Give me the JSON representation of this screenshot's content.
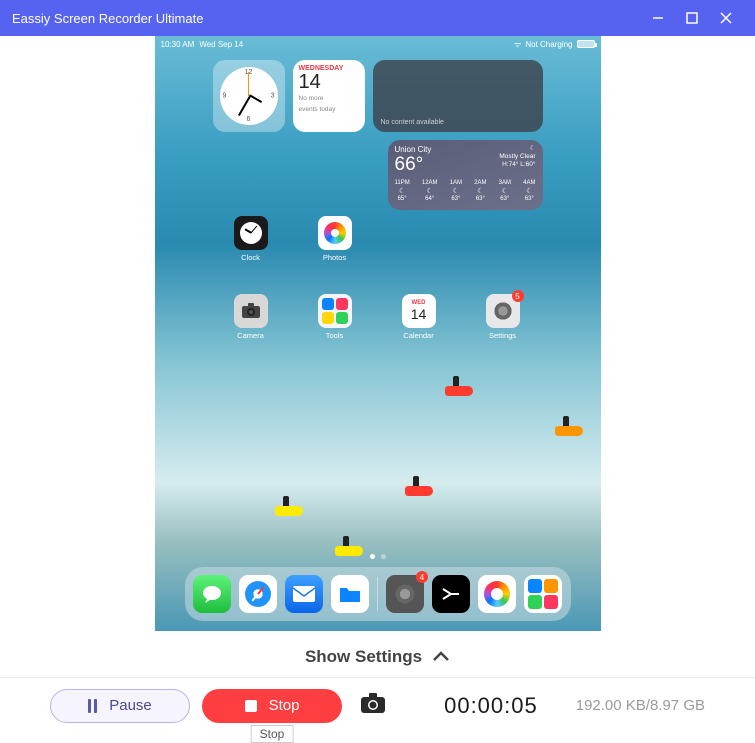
{
  "window": {
    "title": "Eassiy Screen Recorder Ultimate"
  },
  "ipad": {
    "status": {
      "time": "10:30 AM",
      "date": "Wed Sep 14",
      "charge": "Not Charging"
    },
    "widgets": {
      "clock": {
        "n12": "12",
        "n3": "3",
        "n6": "6",
        "n9": "9"
      },
      "calendar": {
        "dow": "WEDNESDAY",
        "day": "14",
        "note1": "No more",
        "note2": "events today"
      },
      "empty": {
        "text": "No content available"
      },
      "weather": {
        "city": "Union City",
        "temp": "66°",
        "desc": "Mostly Clear",
        "hilo": "H:74° L:60°",
        "hours": [
          {
            "t": "11PM",
            "v": "65°"
          },
          {
            "t": "12AM",
            "v": "64°"
          },
          {
            "t": "1AM",
            "v": "63°"
          },
          {
            "t": "2AM",
            "v": "63°"
          },
          {
            "t": "3AM",
            "v": "63°"
          },
          {
            "t": "4AM",
            "v": "63°"
          }
        ]
      }
    },
    "apps": {
      "row1": [
        {
          "id": "clock",
          "label": "Clock"
        },
        {
          "id": "photos",
          "label": "Photos"
        }
      ],
      "row2": [
        {
          "id": "camera",
          "label": "Camera"
        },
        {
          "id": "tools",
          "label": "Tools"
        },
        {
          "id": "calendar",
          "label": "Calendar",
          "dow": "WED",
          "day": "14"
        },
        {
          "id": "settings",
          "label": "Settings",
          "badge": "5"
        }
      ]
    },
    "dock": {
      "items": [
        "messages",
        "safari",
        "mail",
        "files"
      ],
      "recent": [
        "settings",
        "terminal",
        "photos",
        "widgets"
      ],
      "settings_badge": "4"
    }
  },
  "show_settings": {
    "label": "Show Settings"
  },
  "controls": {
    "pause": "Pause",
    "stop": "Stop",
    "stop_tooltip": "Stop",
    "timer": "00:00:05",
    "filesize": "192.00 KB/8.97 GB"
  }
}
